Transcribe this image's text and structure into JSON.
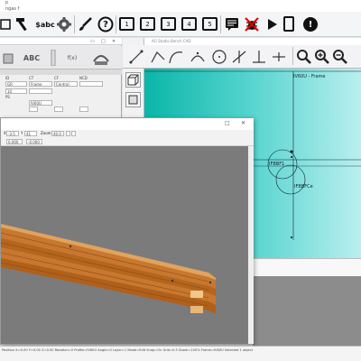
{
  "app": {
    "title": "p",
    "menu": "ngas  f"
  },
  "toolbar": {
    "abc_label": "$abc",
    "numbered_views": [
      "1",
      "2",
      "3",
      "4",
      "5"
    ],
    "stop_label": "!",
    "help_label": "?"
  },
  "left_panel": {
    "icon_abc": "ABC",
    "icon_fx": "f(x)",
    "fields": [
      {
        "label": "ID",
        "value": "GR"
      },
      {
        "label": "CT",
        "value": "Frame"
      },
      {
        "label": "CF",
        "value": "Central"
      },
      {
        "label": "NCD",
        "value": ""
      },
      {
        "label": "PS",
        "value": "IV60U"
      },
      {
        "label": "V",
        "value": "10"
      }
    ]
  },
  "cad": {
    "window_title": "AG Studio Bench CAD",
    "labels": {
      "frame": "IV60U - Frame",
      "ifb1": "IFBBF1",
      "ifb2": "IFBBFCe"
    }
  },
  "popup": {
    "fields": [
      "-3.5",
      "41",
      "40.0",
      "0.000",
      "-0.000"
    ],
    "zoom_label": "Zoom",
    "x_label": "X",
    "y_label": "Y"
  },
  "statusbar": {
    "text": "Position X=0.00 Y=0.00 Z=0.00 Rotation=0 Profile=IV60U Angle=0 Layer=1 Mode=Edit Snap=On Grid=0.5 Zoom=100% Frame=IV60U    Selected 1 object"
  }
}
